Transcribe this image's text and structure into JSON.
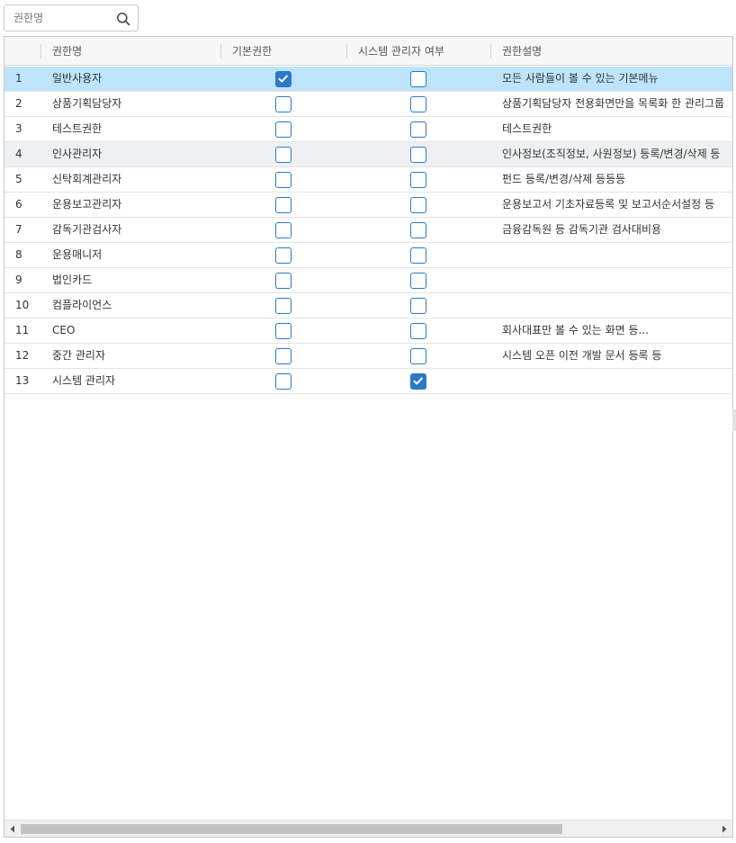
{
  "search": {
    "placeholder": "권한명"
  },
  "columns": {
    "name": "권한명",
    "basic": "기본권한",
    "system": "시스템 관리자 여부",
    "desc": "권한설명"
  },
  "rows": [
    {
      "no": "1",
      "name": "일반사용자",
      "basic": true,
      "system": false,
      "desc": "모든 사람들이 볼 수 있는 기본메뉴"
    },
    {
      "no": "2",
      "name": "상품기획담당자",
      "basic": false,
      "system": false,
      "desc": "상품기획담당자 전용화면만을 목록화 한 관리그룹"
    },
    {
      "no": "3",
      "name": "테스트권한",
      "basic": false,
      "system": false,
      "desc": "테스트권한"
    },
    {
      "no": "4",
      "name": "인사관리자",
      "basic": false,
      "system": false,
      "desc": "인사정보(조직정보, 사원정보) 등록/변경/삭제 등"
    },
    {
      "no": "5",
      "name": "신탁회계관리자",
      "basic": false,
      "system": false,
      "desc": "펀드 등록/변경/삭제 등등등"
    },
    {
      "no": "6",
      "name": "운용보고관리자",
      "basic": false,
      "system": false,
      "desc": "운용보고서 기초자료등록 및 보고서순서설정 등"
    },
    {
      "no": "7",
      "name": "감독기관검사자",
      "basic": false,
      "system": false,
      "desc": "금융감독원 등 감독기관 검사대비용"
    },
    {
      "no": "8",
      "name": "운용매니저",
      "basic": false,
      "system": false,
      "desc": ""
    },
    {
      "no": "9",
      "name": "법인카드",
      "basic": false,
      "system": false,
      "desc": ""
    },
    {
      "no": "10",
      "name": "컴플라이언스",
      "basic": false,
      "system": false,
      "desc": ""
    },
    {
      "no": "11",
      "name": "CEO",
      "basic": false,
      "system": false,
      "desc": "회사대표만 볼 수 있는 화면 등..."
    },
    {
      "no": "12",
      "name": "중간 관리자",
      "basic": false,
      "system": false,
      "desc": "시스템 오픈 이전 개발 문서 등록 등"
    },
    {
      "no": "13",
      "name": "시스템 관리자",
      "basic": false,
      "system": true,
      "desc": ""
    }
  ],
  "selected_row": 1,
  "hover_row": 4,
  "icons": {
    "search": "search-icon",
    "check": "checkmark-icon",
    "scroll_left": "arrow-left-icon",
    "scroll_right": "arrow-right-icon"
  },
  "colors": {
    "accent": "#2d79c7",
    "selected": "#bde4fb",
    "hover": "#eef0f1"
  }
}
